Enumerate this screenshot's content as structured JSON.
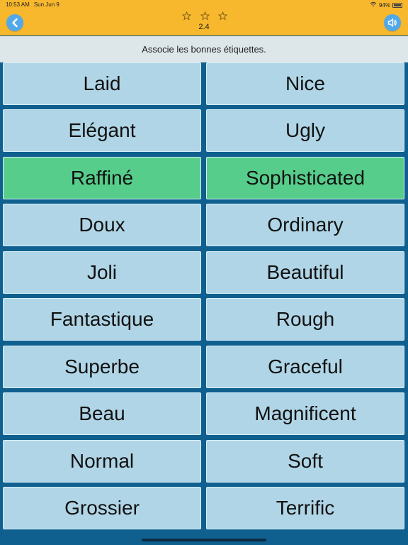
{
  "status": {
    "time": "10:53 AM",
    "date": "Sun Jun 9",
    "battery": "94%"
  },
  "header": {
    "score": "2.4"
  },
  "instruction": "Associe les bonnes étiquettes.",
  "pairs": [
    {
      "left": "Laid",
      "right": "Nice",
      "matched": false
    },
    {
      "left": "Elégant",
      "right": "Ugly",
      "matched": false
    },
    {
      "left": "Raffiné",
      "right": "Sophisticated",
      "matched": true
    },
    {
      "left": "Doux",
      "right": "Ordinary",
      "matched": false
    },
    {
      "left": "Joli",
      "right": "Beautiful",
      "matched": false
    },
    {
      "left": "Fantastique",
      "right": "Rough",
      "matched": false
    },
    {
      "left": "Superbe",
      "right": "Graceful",
      "matched": false
    },
    {
      "left": "Beau",
      "right": "Magnificent",
      "matched": false
    },
    {
      "left": "Normal",
      "right": "Soft",
      "matched": false
    },
    {
      "left": "Grossier",
      "right": "Terrific",
      "matched": false
    }
  ],
  "colors": {
    "background": "#0f5f8f",
    "header": "#f7b82e",
    "card": "#b0d5e6",
    "matched_card": "#56cd8a",
    "button": "#52a9e9"
  },
  "icons": {
    "back": "chevron-left-icon",
    "sound": "speaker-icon",
    "stars": "star-outline-icon",
    "wifi": "wifi-icon",
    "battery": "battery-icon"
  }
}
